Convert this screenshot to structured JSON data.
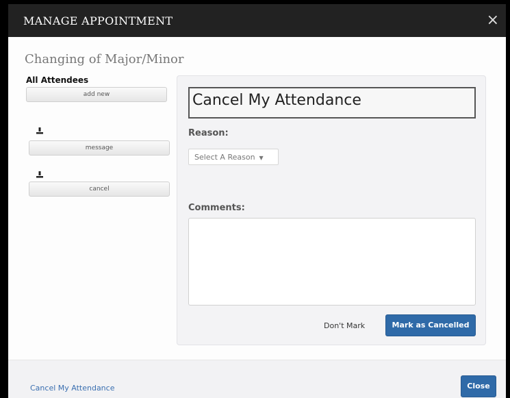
{
  "modal": {
    "title": "MANAGE APPOINTMENT",
    "close_glyph": "×"
  },
  "appointment": {
    "subject": "Changing of Major/Minor"
  },
  "attendees": {
    "heading": "All Attendees",
    "add_new_label": "add new",
    "message_label": "message",
    "cancel_label": "cancel",
    "person_icon": "person-icon"
  },
  "panel": {
    "title": "Cancel My Attendance",
    "reason_label": "Reason:",
    "reason_select": {
      "selected": "Select A Reason",
      "caret": "▼"
    },
    "comments_label": "Comments:",
    "comments_value": "",
    "dont_mark_label": "Don't Mark",
    "mark_cancelled_label": "Mark as Cancelled"
  },
  "footer": {
    "link_label": "Cancel My Attendance",
    "close_label": "Close"
  },
  "colors": {
    "header_bg": "#222222",
    "primary_blue": "#2f6aa8",
    "link_blue": "#3a6fb0",
    "panel_bg": "#f3f3f5"
  }
}
